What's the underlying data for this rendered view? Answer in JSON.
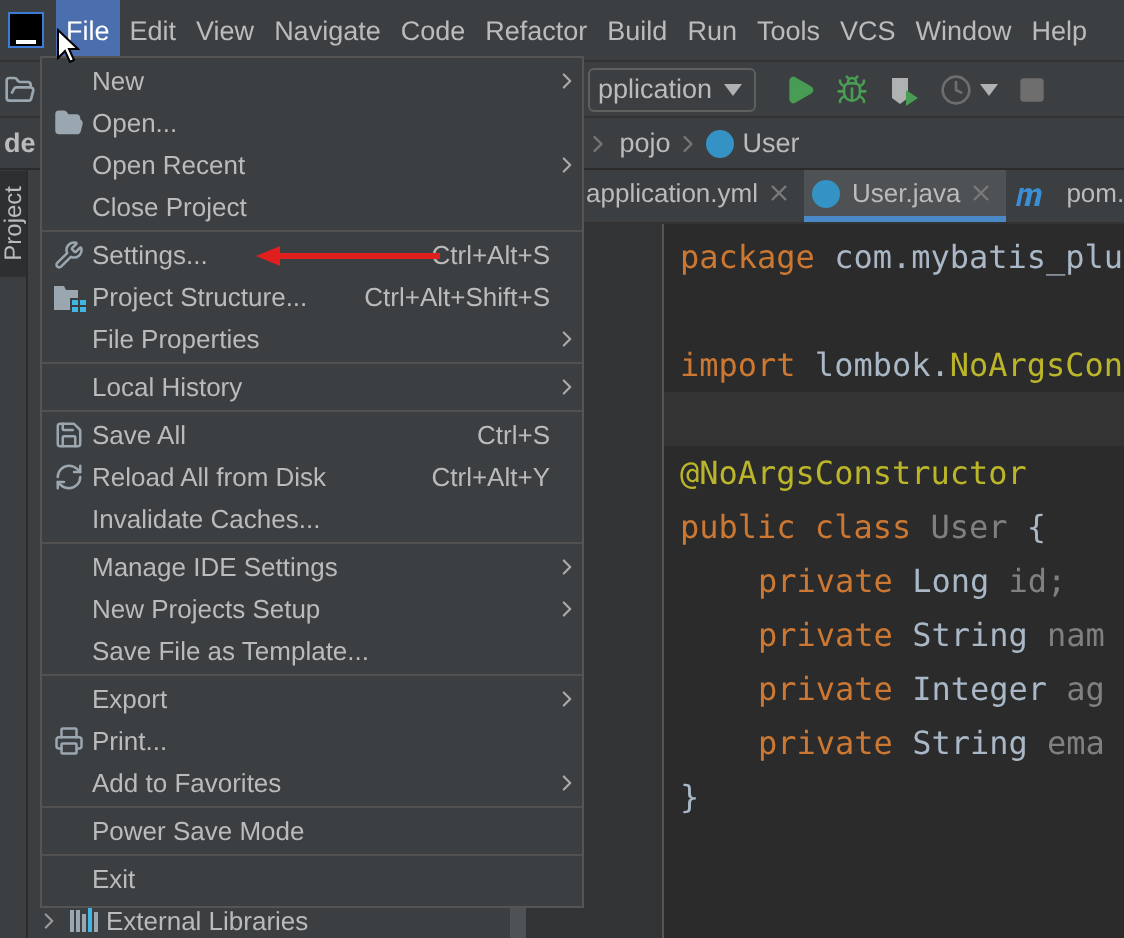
{
  "menubar": [
    {
      "label": "File",
      "selected": true
    },
    {
      "label": "Edit",
      "selected": false
    },
    {
      "label": "View",
      "selected": false
    },
    {
      "label": "Navigate",
      "selected": false
    },
    {
      "label": "Code",
      "selected": false
    },
    {
      "label": "Refactor",
      "selected": false
    },
    {
      "label": "Build",
      "selected": false
    },
    {
      "label": "Run",
      "selected": false
    },
    {
      "label": "Tools",
      "selected": false
    },
    {
      "label": "VCS",
      "selected": false
    },
    {
      "label": "Window",
      "selected": false
    },
    {
      "label": "Help",
      "selected": false
    }
  ],
  "toolbar": {
    "run_configuration": "pplication"
  },
  "breadcrumb": {
    "project": "de",
    "items": [
      "pojo",
      "User"
    ]
  },
  "side_tab": "Project",
  "editor_tabs": [
    {
      "label": "application.yml",
      "kind": "yaml",
      "selected": false
    },
    {
      "label": "User.java",
      "kind": "class",
      "selected": true
    },
    {
      "label": "pom.",
      "kind": "maven",
      "selected": false
    }
  ],
  "code": [
    {
      "kind": "code",
      "indented": false,
      "tokens": [
        {
          "text": "package",
          "kind": "keyword"
        },
        {
          "text": " com.mybatis_plu",
          "kind": "plain"
        }
      ]
    },
    {
      "kind": "blank"
    },
    {
      "kind": "code",
      "indented": false,
      "tokens": [
        {
          "text": "import",
          "kind": "keyword"
        },
        {
          "text": " lombok.",
          "kind": "plain"
        },
        {
          "text": "NoArgsCon",
          "kind": "annotation"
        }
      ]
    },
    {
      "kind": "caret_line"
    },
    {
      "kind": "code",
      "indented": false,
      "tokens": [
        {
          "text": "@NoArgsConstructor",
          "kind": "annotation"
        }
      ]
    },
    {
      "kind": "code",
      "indented": false,
      "tokens": [
        {
          "text": "public class",
          "kind": "keyword"
        },
        {
          "text": " User",
          "kind": "unused"
        },
        {
          "text": " {",
          "kind": "plain"
        }
      ]
    },
    {
      "kind": "code",
      "indented": true,
      "tokens": [
        {
          "text": "private",
          "kind": "keyword"
        },
        {
          "text": " Long",
          "kind": "plain"
        },
        {
          "text": " id;",
          "kind": "unused"
        }
      ]
    },
    {
      "kind": "code",
      "indented": true,
      "tokens": [
        {
          "text": "private",
          "kind": "keyword"
        },
        {
          "text": " String",
          "kind": "plain"
        },
        {
          "text": " nam",
          "kind": "unused"
        }
      ]
    },
    {
      "kind": "code",
      "indented": true,
      "tokens": [
        {
          "text": "private",
          "kind": "keyword"
        },
        {
          "text": " Integer",
          "kind": "plain"
        },
        {
          "text": " ag",
          "kind": "unused"
        }
      ]
    },
    {
      "kind": "code",
      "indented": true,
      "tokens": [
        {
          "text": "private",
          "kind": "keyword"
        },
        {
          "text": " String",
          "kind": "plain"
        },
        {
          "text": " ema",
          "kind": "unused"
        }
      ]
    },
    {
      "kind": "code",
      "indented": false,
      "tokens": [
        {
          "text": "}",
          "kind": "plain"
        }
      ]
    }
  ],
  "project_tree": [
    {
      "label": "External Libraries",
      "expanded": false
    }
  ],
  "file_menu": [
    [
      {
        "label": "New",
        "submenu": true
      },
      {
        "label": "Open...",
        "submenu": false
      },
      {
        "label": "Open Recent",
        "submenu": true
      },
      {
        "label": "Close Project",
        "submenu": false
      }
    ],
    [
      {
        "label": "Settings...",
        "shortcut": "Ctrl+Alt+S",
        "submenu": false
      },
      {
        "label": "Project Structure...",
        "shortcut": "Ctrl+Alt+Shift+S",
        "submenu": false
      },
      {
        "label": "File Properties",
        "submenu": true
      }
    ],
    [
      {
        "label": "Local History",
        "submenu": true
      }
    ],
    [
      {
        "label": "Save All",
        "shortcut": "Ctrl+S",
        "submenu": false
      },
      {
        "label": "Reload All from Disk",
        "shortcut": "Ctrl+Alt+Y",
        "submenu": false
      },
      {
        "label": "Invalidate Caches...",
        "submenu": false
      }
    ],
    [
      {
        "label": "Manage IDE Settings",
        "submenu": true
      },
      {
        "label": "New Projects Setup",
        "submenu": true
      },
      {
        "label": "Save File as Template...",
        "submenu": false
      }
    ],
    [
      {
        "label": "Export",
        "submenu": true
      },
      {
        "label": "Print...",
        "submenu": false
      },
      {
        "label": "Add to Favorites",
        "submenu": true
      }
    ],
    [
      {
        "label": "Power Save Mode",
        "submenu": false
      }
    ],
    [
      {
        "label": "Exit",
        "submenu": false
      }
    ]
  ]
}
